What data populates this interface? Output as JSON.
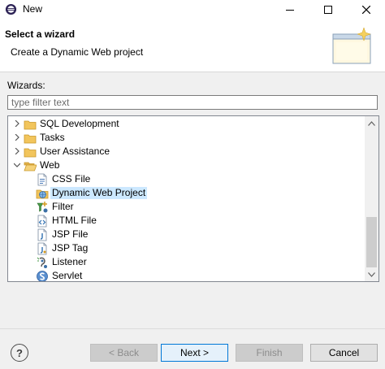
{
  "window": {
    "title": "New",
    "close_color": "#000000"
  },
  "header": {
    "title": "Select a wizard",
    "description": "Create a Dynamic Web project",
    "banner_icon": "wizard-banner-icon"
  },
  "wizards_label": "Wizards:",
  "filter": {
    "placeholder": "type filter text",
    "value": ""
  },
  "tree": {
    "items": [
      {
        "label": "SQL Development",
        "icon": "folder-icon",
        "expanded": false,
        "level": 0
      },
      {
        "label": "Tasks",
        "icon": "folder-icon",
        "expanded": false,
        "level": 0
      },
      {
        "label": "User Assistance",
        "icon": "folder-icon",
        "expanded": false,
        "level": 0
      },
      {
        "label": "Web",
        "icon": "folder-open-icon",
        "expanded": true,
        "level": 0
      },
      {
        "label": "CSS File",
        "icon": "css-file-icon",
        "level": 1
      },
      {
        "label": "Dynamic Web Project",
        "icon": "web-project-icon",
        "level": 1,
        "selected": true
      },
      {
        "label": "Filter",
        "icon": "filter-icon",
        "level": 1
      },
      {
        "label": "HTML File",
        "icon": "html-file-icon",
        "level": 1
      },
      {
        "label": "JSP File",
        "icon": "jsp-file-icon",
        "level": 1
      },
      {
        "label": "JSP Tag",
        "icon": "jsp-tag-icon",
        "level": 1
      },
      {
        "label": "Listener",
        "icon": "listener-icon",
        "level": 1
      },
      {
        "label": "Servlet",
        "icon": "servlet-icon",
        "level": 1
      }
    ],
    "selection_color": "#cce8ff"
  },
  "buttons": {
    "help": "?",
    "back": "< Back",
    "next": "Next >",
    "finish": "Finish",
    "cancel": "Cancel"
  }
}
